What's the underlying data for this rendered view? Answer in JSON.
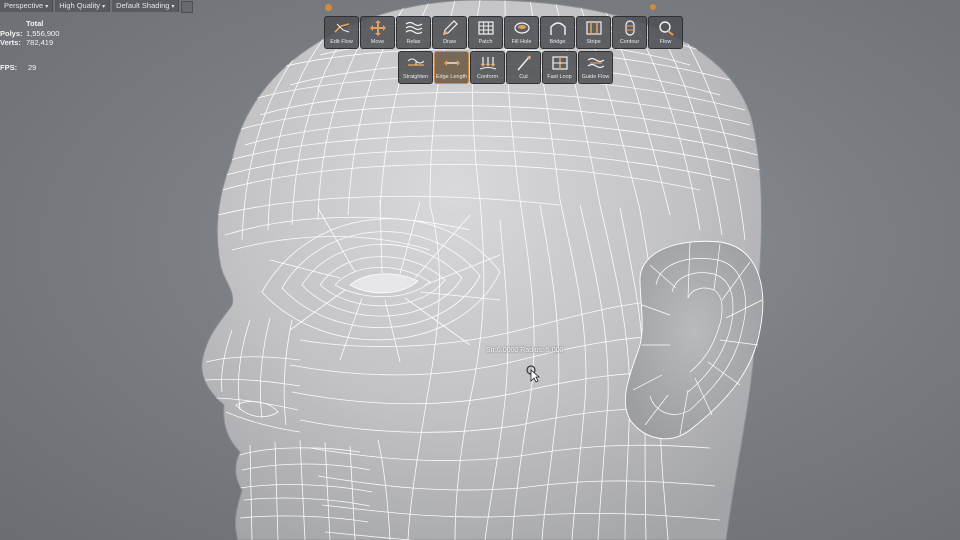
{
  "viewport_menu": {
    "camera": "Perspective",
    "quality": "High Quality",
    "shading": "Default Shading"
  },
  "stats": {
    "header": "Total",
    "polys_label": "Polys:",
    "polys_value": "1,556,900",
    "verts_label": "Verts:",
    "verts_value": "782,419",
    "fps_label": "FPS:",
    "fps_value": "29"
  },
  "toolbar": {
    "row1": [
      {
        "label": "Edit Flow",
        "icon": "edit-flow-icon"
      },
      {
        "label": "Move",
        "icon": "move-icon"
      },
      {
        "label": "Relax",
        "icon": "relax-icon"
      },
      {
        "label": "Draw",
        "icon": "pencil-icon"
      },
      {
        "label": "Patch",
        "icon": "patch-grid-icon"
      },
      {
        "label": "Fill Hole",
        "icon": "fill-hole-icon"
      },
      {
        "label": "Bridge",
        "icon": "bridge-icon"
      },
      {
        "label": "Stripe",
        "icon": "stripe-icon"
      },
      {
        "label": "Contour",
        "icon": "contour-icon"
      },
      {
        "label": "Flow",
        "icon": "flow-icon"
      }
    ],
    "row2": [
      {
        "label": "Straighten",
        "icon": "straighten-icon"
      },
      {
        "label": "Edge Length",
        "icon": "edge-length-icon",
        "active": true
      },
      {
        "label": "Conform",
        "icon": "conform-icon"
      },
      {
        "label": "Cut",
        "icon": "cut-icon"
      },
      {
        "label": "Fast Loop",
        "icon": "fast-loop-icon"
      },
      {
        "label": "Guide Flow",
        "icon": "guide-flow-icon"
      }
    ]
  },
  "brush_readout": "Str:0.0000  Radius: 5.000",
  "colors": {
    "accent": "#e6a35a",
    "wire": "#ffffff",
    "skin": "#c9c9cb",
    "background": "#7e8186"
  }
}
